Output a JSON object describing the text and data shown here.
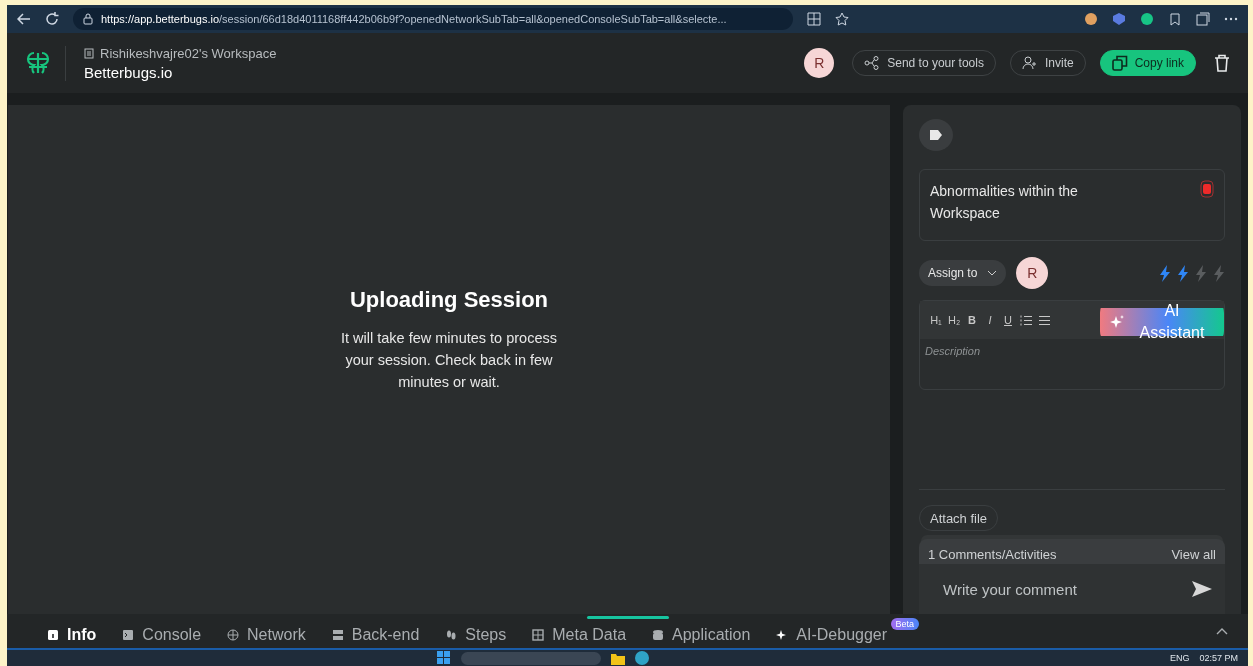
{
  "browser": {
    "url_host": "https://app.betterbugs.io",
    "url_path": "/session/66d18d4011168ff442b06b9f?openedNetworkSubTab=all&openedConsoleSubTab=all&selecte..."
  },
  "header": {
    "workspace": "Rishikeshvajre02's Workspace",
    "app_name": "Betterbugs.io",
    "avatar": "R",
    "send_button": "Send to your tools",
    "invite_button": "Invite",
    "copy_button": "Copy link"
  },
  "stage": {
    "title": "Uploading Session",
    "message": "It will take few minutes to process your session. Check back in few minutes or wait."
  },
  "side": {
    "title": "Abnormalities within the Workspace",
    "assign": "Assign to",
    "assignee": "R",
    "priority": {
      "stars": 2
    },
    "toolbar": [
      "H₁",
      "H₂",
      "B",
      "I",
      "U"
    ],
    "ai_button": "AI Assistant",
    "description": {
      "placeholder": "Description"
    },
    "attach": "Attach file",
    "comments_count": "1 Comments/Activities",
    "view_all": "View all",
    "comment": {
      "placeholder": "Write your comment"
    }
  },
  "tabs": [
    {
      "label": "Info",
      "selected": true
    },
    {
      "label": "Console",
      "selected": false
    },
    {
      "label": "Network",
      "selected": false
    },
    {
      "label": "Back-end",
      "selected": false
    },
    {
      "label": "Steps",
      "selected": false
    },
    {
      "label": "Meta Data",
      "selected": false
    },
    {
      "label": "Application",
      "selected": false
    },
    {
      "label": "AI-Debugger",
      "selected": false,
      "badge": "Beta"
    }
  ],
  "taskbar": {
    "language": "ENG",
    "time": "02:57 PM"
  }
}
